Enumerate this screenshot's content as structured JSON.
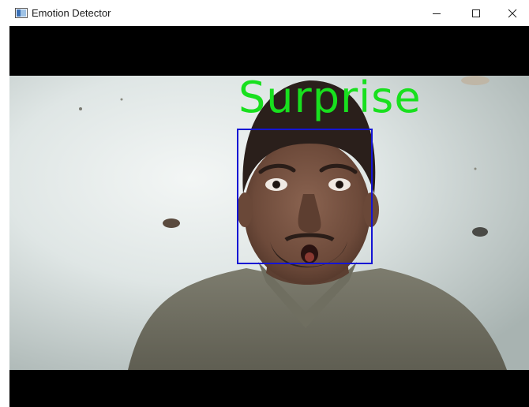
{
  "window": {
    "title": "Emotion Detector",
    "icon": "opencv-window-icon",
    "controls": [
      "minimize-icon",
      "maximize-icon",
      "close-icon"
    ]
  },
  "detection": {
    "emotion": "Surprise",
    "label_color": "#18e01e",
    "box_color": "#1414d4"
  }
}
